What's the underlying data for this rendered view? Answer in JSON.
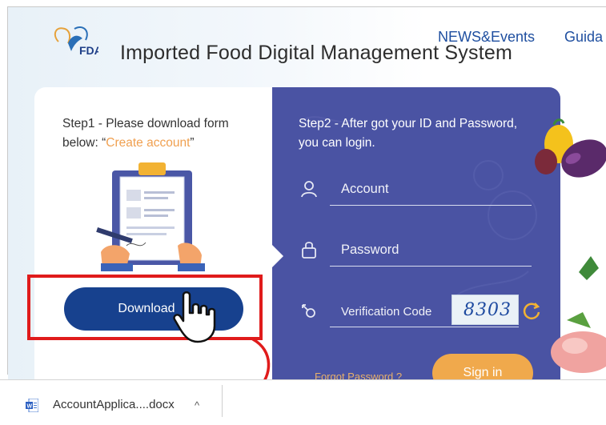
{
  "header": {
    "site_title": "Imported Food Digital Management System",
    "logo_text": "FDA",
    "nav": [
      {
        "label": "NEWS&Events"
      },
      {
        "label": "Guida"
      }
    ]
  },
  "step1": {
    "text_before": "Step1 - Please download form below: “",
    "link_text": "Create account",
    "text_after": "”",
    "download_label": "Download"
  },
  "step2": {
    "text": "Step2 - After got your ID and Password, you can login.",
    "account_placeholder": "Account",
    "password_placeholder": "Password",
    "verification_placeholder": "Verification Code",
    "captcha_value": "8303",
    "forgot_label": "Forgot Password ?",
    "signin_label": "Sign in"
  },
  "download_bar": {
    "file_name": "AccountApplica....docx",
    "caret": "^"
  },
  "colors": {
    "login_panel": "#4a53a3",
    "download_button": "#17418e",
    "signin_button": "#f0a94c",
    "highlight": "#e01b1b",
    "link": "#f0a050"
  },
  "icons": [
    "fda-logo-icon",
    "clipboard-illustration",
    "user-icon",
    "lock-icon",
    "key-icon",
    "refresh-icon",
    "hand-cursor-icon",
    "word-doc-icon"
  ]
}
